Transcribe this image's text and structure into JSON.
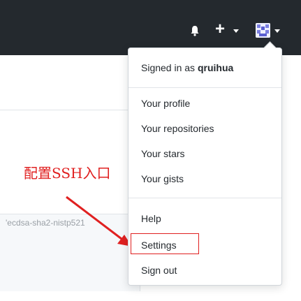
{
  "topbar": {
    "bell_icon": "bell-icon",
    "plus_label": "+",
    "avatar_icon": "avatar-icon",
    "background": "#24292e"
  },
  "background_page": {
    "key_text": "'ecdsa-sha2-nistp521"
  },
  "annotation": {
    "label": "配置SSH入口",
    "color": "#e02020"
  },
  "dropdown": {
    "signed_in_prefix": "Signed in as ",
    "username": "qruihua",
    "items": [
      {
        "label": "Your profile"
      },
      {
        "label": "Your repositories"
      },
      {
        "label": "Your stars"
      },
      {
        "label": "Your gists"
      },
      {
        "label": "Help"
      },
      {
        "label": "Settings"
      },
      {
        "label": "Sign out"
      }
    ]
  }
}
